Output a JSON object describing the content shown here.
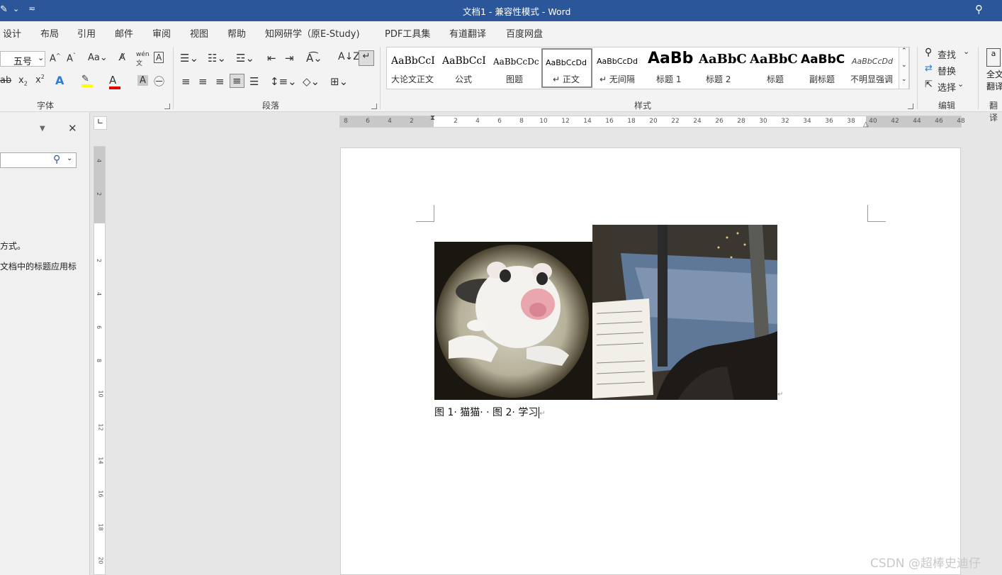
{
  "titlebar": {
    "title": "文档1  -  兼容性模式  -  Word",
    "bg_color": "#2b579a"
  },
  "tabs": [
    "设计",
    "布局",
    "引用",
    "邮件",
    "审阅",
    "视图",
    "帮助",
    "知网研学（原E-Study)",
    "PDF工具集",
    "有道翻译",
    "百度网盘"
  ],
  "ribbon": {
    "font": {
      "size_value": "五号",
      "group_label": "字体"
    },
    "paragraph": {
      "group_label": "段落"
    },
    "styles": {
      "group_label": "样式",
      "items": [
        {
          "preview": "AaBbCcI",
          "label": "大论文正文"
        },
        {
          "preview": "AaBbCcI",
          "label": "公式"
        },
        {
          "preview": "AaBbCcDc",
          "label": "图题"
        },
        {
          "preview": "AaBbCcDd",
          "label": "↵ 正文"
        },
        {
          "preview": "AaBbCcDd",
          "label": "↵ 无间隔"
        },
        {
          "preview": "AaBb",
          "label": "标题 1"
        },
        {
          "preview": "AaBbC",
          "label": "标题 2"
        },
        {
          "preview": "AaBbC",
          "label": "标题"
        },
        {
          "preview": "AaBbC",
          "label": "副标题"
        },
        {
          "preview": "AaBbCcDd",
          "label": "不明显强调"
        }
      ]
    },
    "editing": {
      "find": "查找",
      "replace": "替换",
      "select": "选择",
      "group_label": "编辑"
    },
    "translate": {
      "label_line1": "全文",
      "label_line2": "翻译",
      "group_label": "翻译"
    }
  },
  "navpane": {
    "text_line1": "方式。",
    "text_line2": "文档中的标题应用标"
  },
  "ruler": {
    "h_ticks": [
      "8",
      "6",
      "4",
      "2",
      "2",
      "4",
      "6",
      "8",
      "10",
      "12",
      "14",
      "16",
      "18",
      "20",
      "22",
      "24",
      "26",
      "28",
      "30",
      "32",
      "34",
      "36",
      "38",
      "40",
      "42",
      "44",
      "46",
      "48"
    ],
    "v_ticks": [
      "4",
      "2",
      "2",
      "4",
      "6",
      "8",
      "10",
      "12",
      "14",
      "16",
      "18",
      "20"
    ]
  },
  "document": {
    "caption": "图 1· 猫猫· · 图 2· 学习",
    "image1_alt": "猫猫",
    "image2_alt": "学习"
  },
  "watermark": "CSDN @超棒史迪仔",
  "accent": "#2b579a"
}
